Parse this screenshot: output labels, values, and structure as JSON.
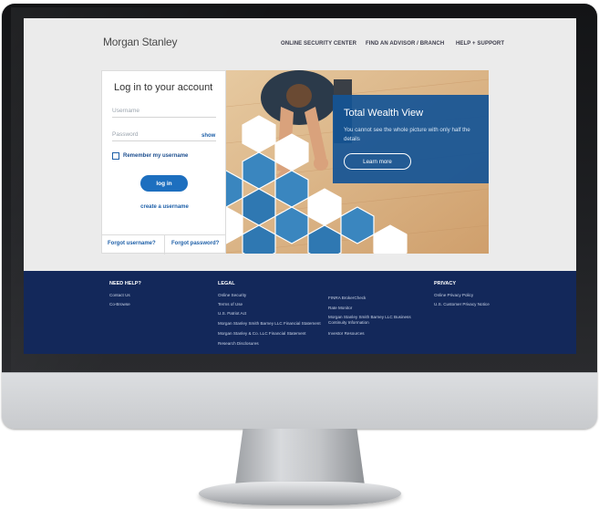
{
  "header": {
    "logo": "Morgan Stanley",
    "nav": [
      "ONLINE SECURITY CENTER",
      "FIND AN ADVISOR / BRANCH",
      "HELP + SUPPORT"
    ]
  },
  "login": {
    "title": "Log in to your account",
    "username_placeholder": "Username",
    "password_placeholder": "Password",
    "show_label": "show",
    "remember_label": "Remember my username",
    "button_label": "log in",
    "create_label": "create a username",
    "forgot_username": "Forgot username?",
    "forgot_password": "Forgot password?"
  },
  "promo": {
    "title": "Total Wealth View",
    "subtitle": "You cannot see the whole picture with only half the details",
    "button_label": "Learn more"
  },
  "footer": {
    "need_help": {
      "heading": "NEED HELP?",
      "links": [
        "Contact Us",
        "Co-Browse"
      ]
    },
    "legal": {
      "heading": "LEGAL",
      "col1": [
        "Online Security",
        "Terms of Use",
        "U.S. Patriot Act",
        "Morgan Stanley Smith Barney LLC Financial Statement",
        "Morgan Stanley & Co. LLC Financial Statement",
        "Research Disclosures"
      ],
      "col2": [
        "FINRA BrokerCheck",
        "Rate Monitor",
        "Morgan Stanley Smith Barney LLC Business Continuity Information",
        "Investor Resources"
      ]
    },
    "privacy": {
      "heading": "PRIVACY",
      "links": [
        "Online Privacy Policy",
        "U.S. Customer Privacy Notice"
      ]
    }
  },
  "colors": {
    "footer_bg": "#13285a",
    "brand_blue": "#1d6fbf",
    "promo_bg": "#145496"
  }
}
